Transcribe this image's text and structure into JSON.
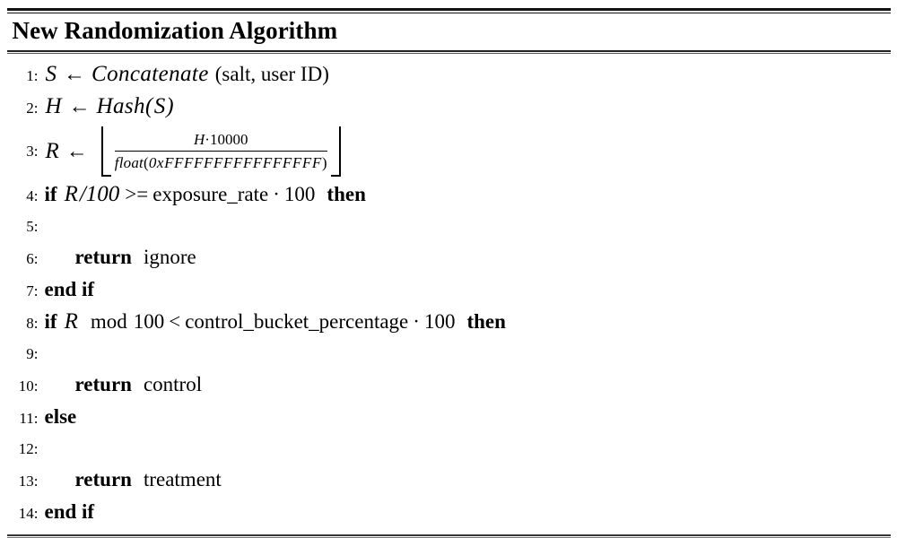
{
  "algorithm": {
    "caption": "New Randomization Algorithm",
    "lines": [
      {
        "number": "1:",
        "kind": "assign",
        "lhs": "S",
        "arrow": "←",
        "func": "Concatenate",
        "args": "(salt, user ID)"
      },
      {
        "number": "2:",
        "kind": "assign_call",
        "lhs": "H",
        "arrow": "←",
        "func": "Hash",
        "open": "(",
        "arg": "S",
        "close": ")"
      },
      {
        "number": "3:",
        "kind": "floor_fraction",
        "lhs": "R",
        "arrow": "←",
        "floor_left": "⌊",
        "floor_right": "⌋",
        "numerator_var": "H",
        "numerator_op": "·",
        "numerator_num": "10000",
        "denominator_func": "float",
        "denominator_open": "(",
        "denominator_hex": "0xFFFFFFFFFFFFFFFF",
        "denominator_close": ")"
      },
      {
        "number": "4:",
        "kind": "if",
        "keyword_if": "if",
        "var": "R",
        "div": "/100",
        "comparator": ">=",
        "operand": "exposure_rate",
        "mult": "·",
        "factor": "100",
        "keyword_then": "then"
      },
      {
        "number": "5:",
        "kind": "blank"
      },
      {
        "number": "6:",
        "kind": "return",
        "indent": true,
        "keyword": "return",
        "value": "ignore"
      },
      {
        "number": "7:",
        "kind": "endif",
        "keyword": "end if"
      },
      {
        "number": "8:",
        "kind": "if_mod",
        "keyword_if": "if",
        "var": "R",
        "mod": "mod",
        "modulus": "100",
        "comparator": "<",
        "operand": "control_bucket_percentage",
        "mult": "·",
        "factor": "100",
        "keyword_then": "then"
      },
      {
        "number": "9:",
        "kind": "blank"
      },
      {
        "number": "10:",
        "kind": "return",
        "indent": true,
        "keyword": "return",
        "value": "control"
      },
      {
        "number": "11:",
        "kind": "else",
        "keyword": "else"
      },
      {
        "number": "12:",
        "kind": "blank"
      },
      {
        "number": "13:",
        "kind": "return",
        "indent": true,
        "keyword": "return",
        "value": "treatment"
      },
      {
        "number": "14:",
        "kind": "endif",
        "keyword": "end if"
      }
    ]
  }
}
